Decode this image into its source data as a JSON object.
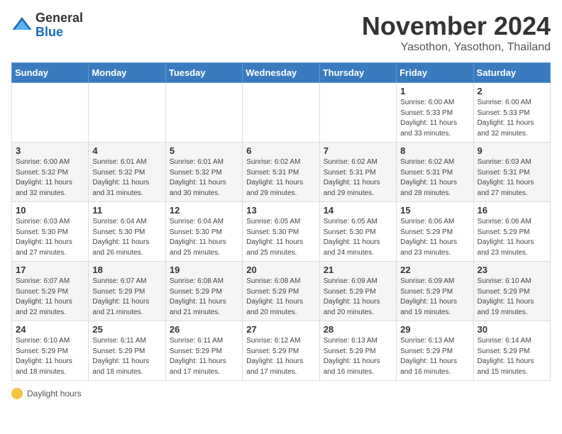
{
  "logo": {
    "general": "General",
    "blue": "Blue"
  },
  "header": {
    "title": "November 2024",
    "location": "Yasothon, Yasothon, Thailand"
  },
  "days_of_week": [
    "Sunday",
    "Monday",
    "Tuesday",
    "Wednesday",
    "Thursday",
    "Friday",
    "Saturday"
  ],
  "legend": {
    "icon": "sun-icon",
    "label": "Daylight hours"
  },
  "weeks": [
    [
      {
        "day": "",
        "info": ""
      },
      {
        "day": "",
        "info": ""
      },
      {
        "day": "",
        "info": ""
      },
      {
        "day": "",
        "info": ""
      },
      {
        "day": "",
        "info": ""
      },
      {
        "day": "1",
        "info": "Sunrise: 6:00 AM\nSunset: 5:33 PM\nDaylight: 11 hours\nand 33 minutes."
      },
      {
        "day": "2",
        "info": "Sunrise: 6:00 AM\nSunset: 5:33 PM\nDaylight: 11 hours\nand 32 minutes."
      }
    ],
    [
      {
        "day": "3",
        "info": "Sunrise: 6:00 AM\nSunset: 5:32 PM\nDaylight: 11 hours\nand 32 minutes."
      },
      {
        "day": "4",
        "info": "Sunrise: 6:01 AM\nSunset: 5:32 PM\nDaylight: 11 hours\nand 31 minutes."
      },
      {
        "day": "5",
        "info": "Sunrise: 6:01 AM\nSunset: 5:32 PM\nDaylight: 11 hours\nand 30 minutes."
      },
      {
        "day": "6",
        "info": "Sunrise: 6:02 AM\nSunset: 5:31 PM\nDaylight: 11 hours\nand 29 minutes."
      },
      {
        "day": "7",
        "info": "Sunrise: 6:02 AM\nSunset: 5:31 PM\nDaylight: 11 hours\nand 29 minutes."
      },
      {
        "day": "8",
        "info": "Sunrise: 6:02 AM\nSunset: 5:31 PM\nDaylight: 11 hours\nand 28 minutes."
      },
      {
        "day": "9",
        "info": "Sunrise: 6:03 AM\nSunset: 5:31 PM\nDaylight: 11 hours\nand 27 minutes."
      }
    ],
    [
      {
        "day": "10",
        "info": "Sunrise: 6:03 AM\nSunset: 5:30 PM\nDaylight: 11 hours\nand 27 minutes."
      },
      {
        "day": "11",
        "info": "Sunrise: 6:04 AM\nSunset: 5:30 PM\nDaylight: 11 hours\nand 26 minutes."
      },
      {
        "day": "12",
        "info": "Sunrise: 6:04 AM\nSunset: 5:30 PM\nDaylight: 11 hours\nand 25 minutes."
      },
      {
        "day": "13",
        "info": "Sunrise: 6:05 AM\nSunset: 5:30 PM\nDaylight: 11 hours\nand 25 minutes."
      },
      {
        "day": "14",
        "info": "Sunrise: 6:05 AM\nSunset: 5:30 PM\nDaylight: 11 hours\nand 24 minutes."
      },
      {
        "day": "15",
        "info": "Sunrise: 6:06 AM\nSunset: 5:29 PM\nDaylight: 11 hours\nand 23 minutes."
      },
      {
        "day": "16",
        "info": "Sunrise: 6:06 AM\nSunset: 5:29 PM\nDaylight: 11 hours\nand 23 minutes."
      }
    ],
    [
      {
        "day": "17",
        "info": "Sunrise: 6:07 AM\nSunset: 5:29 PM\nDaylight: 11 hours\nand 22 minutes."
      },
      {
        "day": "18",
        "info": "Sunrise: 6:07 AM\nSunset: 5:29 PM\nDaylight: 11 hours\nand 21 minutes."
      },
      {
        "day": "19",
        "info": "Sunrise: 6:08 AM\nSunset: 5:29 PM\nDaylight: 11 hours\nand 21 minutes."
      },
      {
        "day": "20",
        "info": "Sunrise: 6:08 AM\nSunset: 5:29 PM\nDaylight: 11 hours\nand 20 minutes."
      },
      {
        "day": "21",
        "info": "Sunrise: 6:09 AM\nSunset: 5:29 PM\nDaylight: 11 hours\nand 20 minutes."
      },
      {
        "day": "22",
        "info": "Sunrise: 6:09 AM\nSunset: 5:29 PM\nDaylight: 11 hours\nand 19 minutes."
      },
      {
        "day": "23",
        "info": "Sunrise: 6:10 AM\nSunset: 5:29 PM\nDaylight: 11 hours\nand 19 minutes."
      }
    ],
    [
      {
        "day": "24",
        "info": "Sunrise: 6:10 AM\nSunset: 5:29 PM\nDaylight: 11 hours\nand 18 minutes."
      },
      {
        "day": "25",
        "info": "Sunrise: 6:11 AM\nSunset: 5:29 PM\nDaylight: 11 hours\nand 18 minutes."
      },
      {
        "day": "26",
        "info": "Sunrise: 6:11 AM\nSunset: 5:29 PM\nDaylight: 11 hours\nand 17 minutes."
      },
      {
        "day": "27",
        "info": "Sunrise: 6:12 AM\nSunset: 5:29 PM\nDaylight: 11 hours\nand 17 minutes."
      },
      {
        "day": "28",
        "info": "Sunrise: 6:13 AM\nSunset: 5:29 PM\nDaylight: 11 hours\nand 16 minutes."
      },
      {
        "day": "29",
        "info": "Sunrise: 6:13 AM\nSunset: 5:29 PM\nDaylight: 11 hours\nand 16 minutes."
      },
      {
        "day": "30",
        "info": "Sunrise: 6:14 AM\nSunset: 5:29 PM\nDaylight: 11 hours\nand 15 minutes."
      }
    ]
  ]
}
